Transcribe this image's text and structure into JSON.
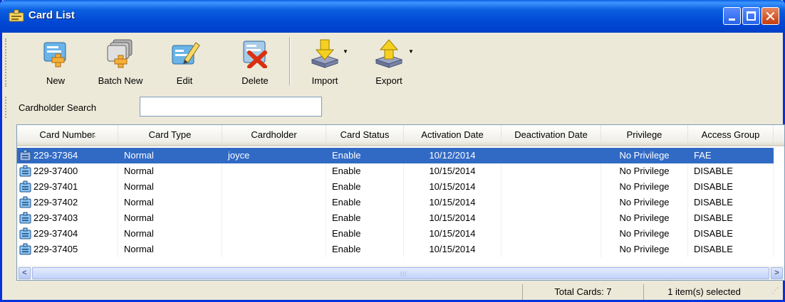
{
  "window": {
    "title": "Card List"
  },
  "toolbar": {
    "buttons": [
      {
        "label": "New",
        "icon": "new-card-icon"
      },
      {
        "label": "Batch New",
        "icon": "batch-new-icon"
      },
      {
        "label": "Edit",
        "icon": "edit-icon"
      },
      {
        "label": "Delete",
        "icon": "delete-icon"
      },
      {
        "label": "Import",
        "icon": "import-icon"
      },
      {
        "label": "Export",
        "icon": "export-icon"
      }
    ]
  },
  "search": {
    "label": "Cardholder Search",
    "value": ""
  },
  "table": {
    "columns": [
      "Card Number",
      "Card Type",
      "Cardholder",
      "Card Status",
      "Activation Date",
      "Deactivation Date",
      "Privilege",
      "Access Group"
    ],
    "rows": [
      {
        "card_number": "229-37364",
        "card_type": "Normal",
        "cardholder": "joyce",
        "status": "Enable",
        "activation": "10/12/2014",
        "deactivation": "",
        "privilege": "No Privilege",
        "access_group": "FAE",
        "selected": true
      },
      {
        "card_number": "229-37400",
        "card_type": "Normal",
        "cardholder": "",
        "status": "Enable",
        "activation": "10/15/2014",
        "deactivation": "",
        "privilege": "No Privilege",
        "access_group": "DISABLE",
        "selected": false
      },
      {
        "card_number": "229-37401",
        "card_type": "Normal",
        "cardholder": "",
        "status": "Enable",
        "activation": "10/15/2014",
        "deactivation": "",
        "privilege": "No Privilege",
        "access_group": "DISABLE",
        "selected": false
      },
      {
        "card_number": "229-37402",
        "card_type": "Normal",
        "cardholder": "",
        "status": "Enable",
        "activation": "10/15/2014",
        "deactivation": "",
        "privilege": "No Privilege",
        "access_group": "DISABLE",
        "selected": false
      },
      {
        "card_number": "229-37403",
        "card_type": "Normal",
        "cardholder": "",
        "status": "Enable",
        "activation": "10/15/2014",
        "deactivation": "",
        "privilege": "No Privilege",
        "access_group": "DISABLE",
        "selected": false
      },
      {
        "card_number": "229-37404",
        "card_type": "Normal",
        "cardholder": "",
        "status": "Enable",
        "activation": "10/15/2014",
        "deactivation": "",
        "privilege": "No Privilege",
        "access_group": "DISABLE",
        "selected": false
      },
      {
        "card_number": "229-37405",
        "card_type": "Normal",
        "cardholder": "",
        "status": "Enable",
        "activation": "10/15/2014",
        "deactivation": "",
        "privilege": "No Privilege",
        "access_group": "DISABLE",
        "selected": false
      }
    ]
  },
  "status": {
    "total": "Total Cards: 7",
    "selected": "1 item(s) selected"
  },
  "colors": {
    "titlebar": "#0a5fe0",
    "selection": "#316ac5",
    "window_bg": "#ece9d8"
  }
}
